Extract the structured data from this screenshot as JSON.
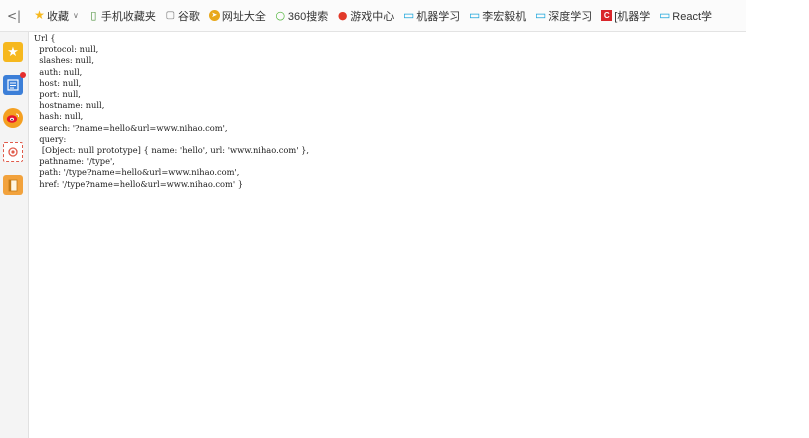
{
  "toolbar": {
    "collapse_label": "<|",
    "favorites_label": "收藏",
    "bookmarks": [
      {
        "label": "手机收藏夹",
        "icon": "mobile-icon"
      },
      {
        "label": "谷歌",
        "icon": "page-icon"
      },
      {
        "label": "网址大全",
        "icon": "compass-icon"
      },
      {
        "label": "360搜索",
        "icon": "search360-icon"
      },
      {
        "label": "游戏中心",
        "icon": "game-icon"
      },
      {
        "label": "机器学习",
        "icon": "bilibili-icon"
      },
      {
        "label": "李宏毅机",
        "icon": "bilibili-icon"
      },
      {
        "label": "深度学习",
        "icon": "bilibili-icon"
      },
      {
        "label": "[机器学",
        "icon": "csdn-icon"
      },
      {
        "label": "React学",
        "icon": "bilibili-icon"
      }
    ]
  },
  "sidebar": {
    "items": [
      "star-icon",
      "news-icon",
      "weibo-icon",
      "screenshot-icon",
      "book-icon"
    ]
  },
  "output": {
    "lines": [
      "Url {",
      "  protocol: null,",
      "  slashes: null,",
      "  auth: null,",
      "  host: null,",
      "  port: null,",
      "  hostname: null,",
      "  hash: null,",
      "  search: '?name=hello&url=www.nihao.com',",
      "  query:",
      "   [Object: null prototype] { name: 'hello', url: 'www.nihao.com' },",
      "  pathname: '/type',",
      "  path: '/type?name=hello&url=www.nihao.com',",
      "  href: '/type?name=hello&url=www.nihao.com' }"
    ]
  },
  "colors": {
    "bilibili": "#1aa4db",
    "csdn": "#d9262b",
    "game": "#e23a2a",
    "search360": "#49b232",
    "star": "#f6b81e"
  }
}
